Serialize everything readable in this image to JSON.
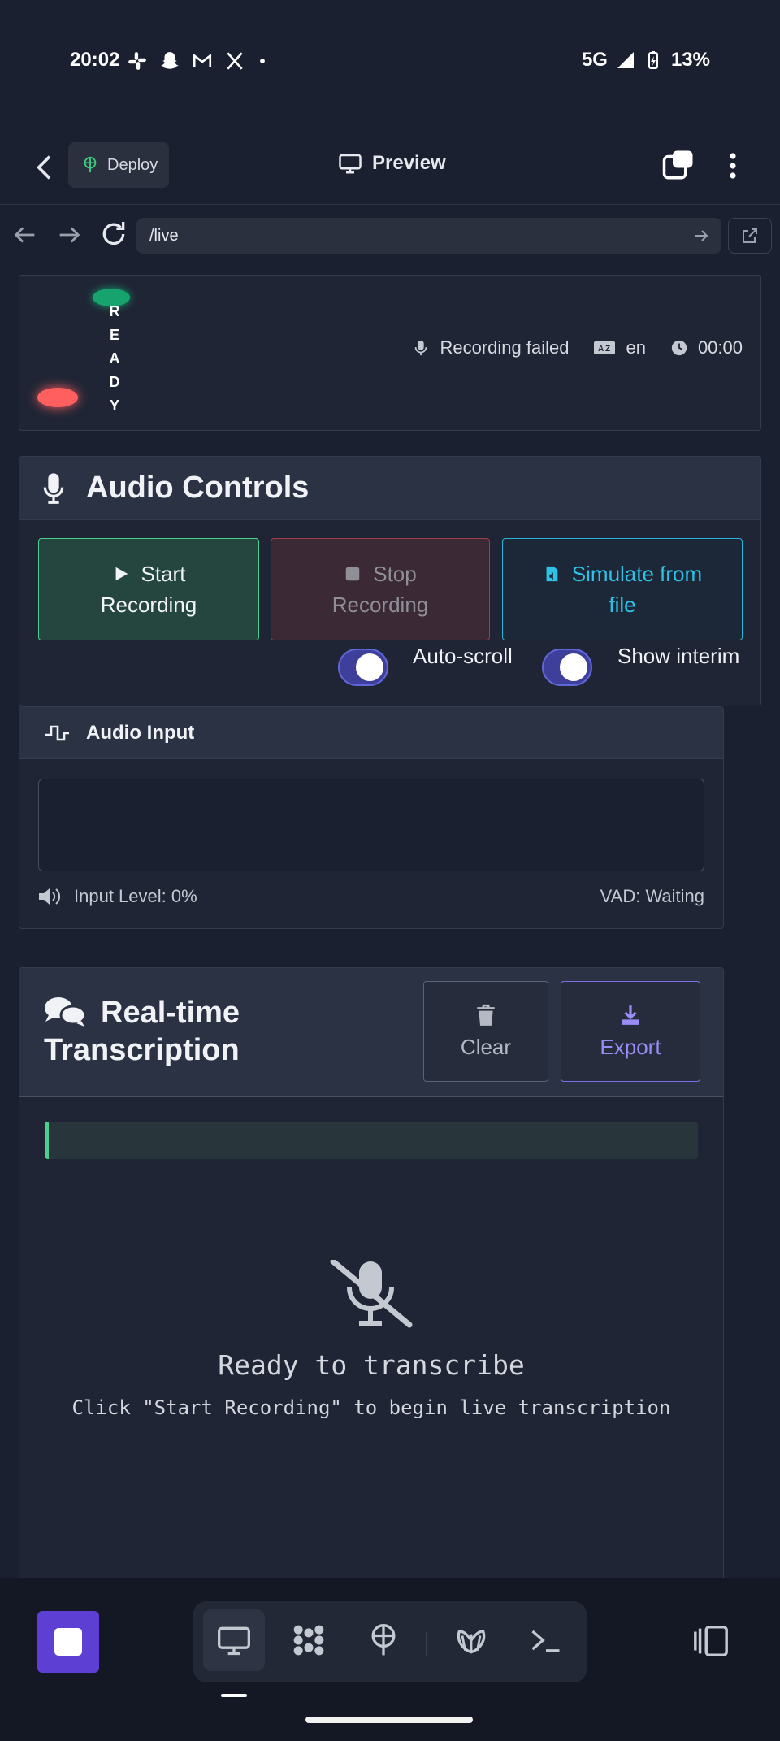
{
  "status_bar": {
    "time": "20:02",
    "network": "5G",
    "battery": "13%",
    "notification_icons": [
      "slack-icon",
      "snapchat-icon",
      "gmail-icon",
      "x-icon",
      "dot-icon"
    ]
  },
  "app_header": {
    "deploy_label": "Deploy",
    "title": "Preview"
  },
  "url_bar": {
    "url": "/live"
  },
  "status_card": {
    "ready_label": "READY",
    "recording_status": "Recording failed",
    "language": "en",
    "timer": "00:00"
  },
  "audio_controls": {
    "title": "Audio Controls",
    "start_line1": "Start",
    "start_line2": "Recording",
    "stop_line1": "Stop",
    "stop_line2": "Recording",
    "simulate_line1": "Simulate from",
    "simulate_line2": "file",
    "auto_scroll_label": "Auto-scroll",
    "show_interim_label": "Show interim",
    "auto_scroll_on": true,
    "show_interim_on": true
  },
  "audio_input": {
    "title": "Audio Input",
    "level_label": "Input Level: 0%",
    "vad_label": "VAD: Waiting"
  },
  "transcription": {
    "title_line1": "Real-time",
    "title_line2": "Transcription",
    "clear_label": "Clear",
    "export_label": "Export",
    "empty_title": "Ready to transcribe",
    "empty_subtitle": "Click \"Start Recording\" to begin live transcription"
  },
  "colors": {
    "accent_green": "#4bd18d",
    "accent_red": "#ff5f5f",
    "accent_cyan": "#30c2e6",
    "accent_purple": "#9a8cf5",
    "toggle": "#3d3f9a"
  }
}
